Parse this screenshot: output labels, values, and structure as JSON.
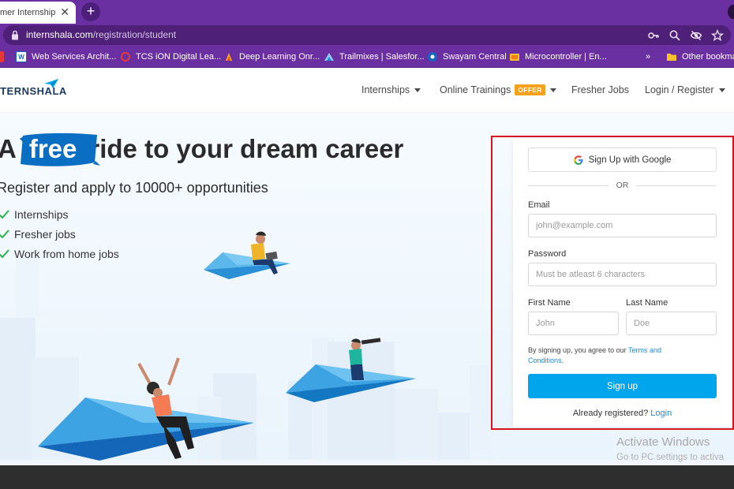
{
  "browser": {
    "tab_title": "mer Internship",
    "url_domain": "internshala.com",
    "url_path": "/registration/student",
    "bookmarks": [
      {
        "label": "Web Services Archit...",
        "icon": "ws-icon",
        "color": "#ffffff"
      },
      {
        "label": "TCS iON Digital Lea...",
        "icon": "tcs-icon",
        "color": "#e53935"
      },
      {
        "label": "Deep Learning Onr...",
        "icon": "deeplearning-icon",
        "color": "#f9a825"
      },
      {
        "label": "Trailmixes | Salesfor...",
        "icon": "trailhead-icon",
        "color": "#1e88e5"
      },
      {
        "label": "Swayam Central",
        "icon": "swayam-icon",
        "color": "#1565c0"
      },
      {
        "label": "Microcontroller | En...",
        "icon": "microcontroller-icon",
        "color": "#fbc02d"
      }
    ],
    "bookmarks_overflow": "»",
    "other_bookmarks": "Other bookma"
  },
  "site": {
    "logo_text": "ITERNSHALA",
    "nav": {
      "internships": "Internships",
      "online_trainings": "Online Trainings",
      "offer_badge": "OFFER",
      "fresher_jobs": "Fresher Jobs",
      "login_register": "Login / Register"
    }
  },
  "hero": {
    "title_prefix": "A",
    "title_highlight": "free",
    "title_suffix": "ride to your dream career",
    "subtitle": "Register and apply to 10000+ opportunities",
    "checklist": [
      "Internships",
      "Fresher jobs",
      "Work from home jobs"
    ]
  },
  "form": {
    "google_button": "Sign Up with Google",
    "or_text": "OR",
    "email_label": "Email",
    "email_placeholder": "john@example.com",
    "password_label": "Password",
    "password_placeholder": "Must be atleast 6 characters",
    "first_name_label": "First Name",
    "first_name_placeholder": "John",
    "last_name_label": "Last Name",
    "last_name_placeholder": "Doe",
    "terms_prefix": "By signing up, you agree to our",
    "terms_link_1": "Terms and",
    "terms_link_2": "Conditions",
    "terms_suffix": ".",
    "signup_button": "Sign up",
    "already_text": "Already registered?",
    "login_link": "Login"
  },
  "watermark": {
    "line1": "Activate Windows",
    "line2": "Go to PC settings to activa"
  },
  "colors": {
    "chrome_purple": "#6a2fa0",
    "brand_blue": "#00a5ec",
    "link_blue": "#1a8bd6",
    "offer_orange": "#f5a11c",
    "highlight_red": "#d9141f",
    "check_green": "#2bb24c"
  }
}
